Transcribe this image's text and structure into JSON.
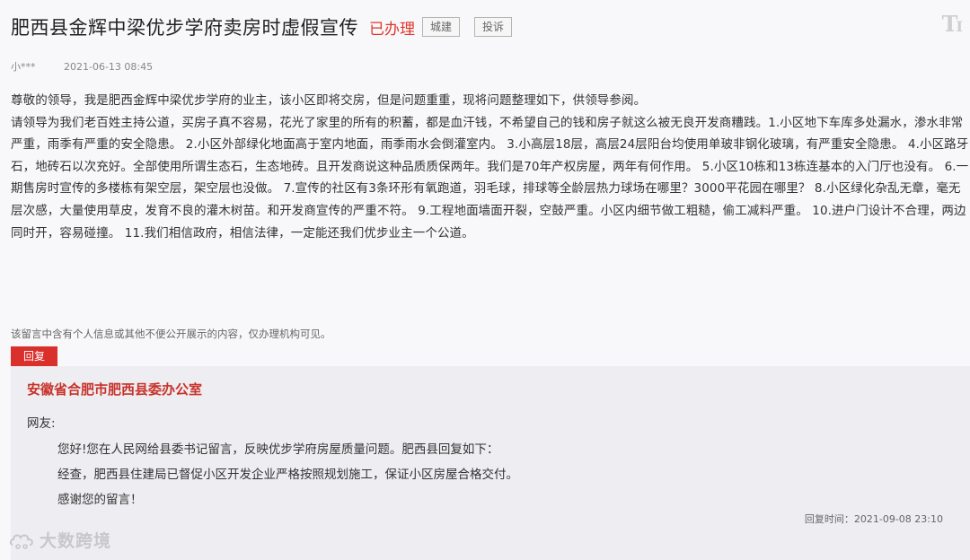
{
  "header": {
    "title": "肥西县金辉中梁优步学府卖房时虚假宣传",
    "status": "已办理",
    "tags": [
      "城建",
      "投诉"
    ]
  },
  "meta": {
    "author": "小***",
    "date": "2021-06-13 08:45"
  },
  "content": {
    "paragraphs": [
      "尊敬的领导，我是肥西金辉中梁优步学府的业主，该小区即将交房，但是问题重重，现将问题整理如下，供领导参阅。",
      "请领导为我们老百姓主持公道，买房子真不容易，花光了家里的所有的积蓄，都是血汗钱，不希望自己的钱和房子就这么被无良开发商糟践。1.小区地下车库多处漏水，渗水非常严重，雨季有严重的安全隐患。 2.小区外部绿化地面高于室内地面，雨季雨水会倒灌室内。 3.小高层18层，高层24层阳台均使用单玻非钢化玻璃，有严重安全隐患。 4.小区路牙石，地砖石以次充好。全部使用所谓生态石，生态地砖。且开发商说这种品质质保两年。我们是70年产权房屋，两年有何作用。 5.小区10栋和13栋连基本的入门厅也没有。 6.一期售房时宣传的多楼栋有架空层，架空层也没做。 7.宣传的社区有3条环形有氧跑道，羽毛球，排球等全龄层热力球场在哪里？3000平花园在哪里？ 8.小区绿化杂乱无章，毫无层次感，大量使用草皮，发育不良的灌木树苗。和开发商宣传的严重不符。 9.工程地面墙面开裂，空鼓严重。小区内细节做工粗糙，偷工减料严重。 10.进户门设计不合理，两边同时开，容易碰撞。 11.我们相信政府，相信法律，一定能还我们优步业主一个公道。"
    ]
  },
  "notice": "该留言中含有个人信息或其他不便公开展示的内容，仅办理机构可见。",
  "reply": {
    "tab_label": "回复",
    "org": "安徽省合肥市肥西县委办公室",
    "greeting": "网友:",
    "lines": [
      "您好!您在人民网给县委书记留言，反映优步学府房屋质量问题。肥西县回复如下：",
      "经查，肥西县住建局已督促小区开发企业严格按照规划施工，保证小区房屋合格交付。",
      "感谢您的留言！"
    ],
    "time": "回复时间：2021-09-08 23:10"
  },
  "watermark": {
    "text": "大数跨境"
  },
  "icons": {
    "text_size": "text-size-icon",
    "watermark_logo": "cloud-logo-icon"
  },
  "colors": {
    "accent_red": "#d9302c",
    "status_red": "#e0352b",
    "org_red": "#c7332b",
    "page_bg": "#f8f7f9",
    "reply_bg": "#eeedf1"
  }
}
